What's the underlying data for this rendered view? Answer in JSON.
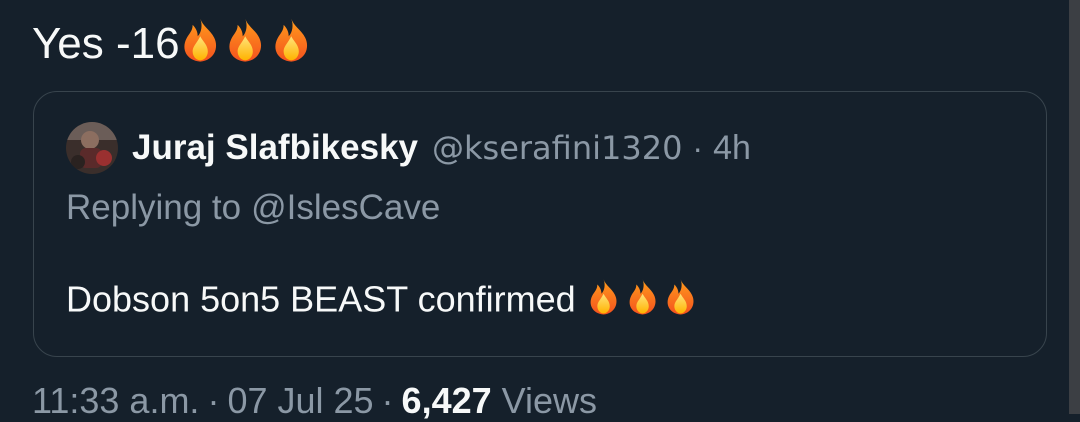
{
  "tweet": {
    "text": "Yes -16",
    "emoji": [
      "fire",
      "fire",
      "fire"
    ]
  },
  "quoted_tweet": {
    "author_name": "Juraj Slafbikesky",
    "handle": "@kserafini1320",
    "separator": "·",
    "time_ago": "4h",
    "reply_prefix": "Replying to",
    "reply_handle": "@IslesCave",
    "text": "Dobson 5on5 BEAST confirmed",
    "emoji": [
      "fire",
      "fire",
      "fire"
    ]
  },
  "meta": {
    "time": "11:33 a.m.",
    "separator": "·",
    "date": "07 Jul 25",
    "views_count": "6,427",
    "views_label": "Views"
  },
  "colors": {
    "background": "#15202b",
    "border": "#38444d",
    "secondary_text": "#8b98a5",
    "primary_text": "#f7f9f9",
    "scrollbar": "#3c3f44"
  }
}
